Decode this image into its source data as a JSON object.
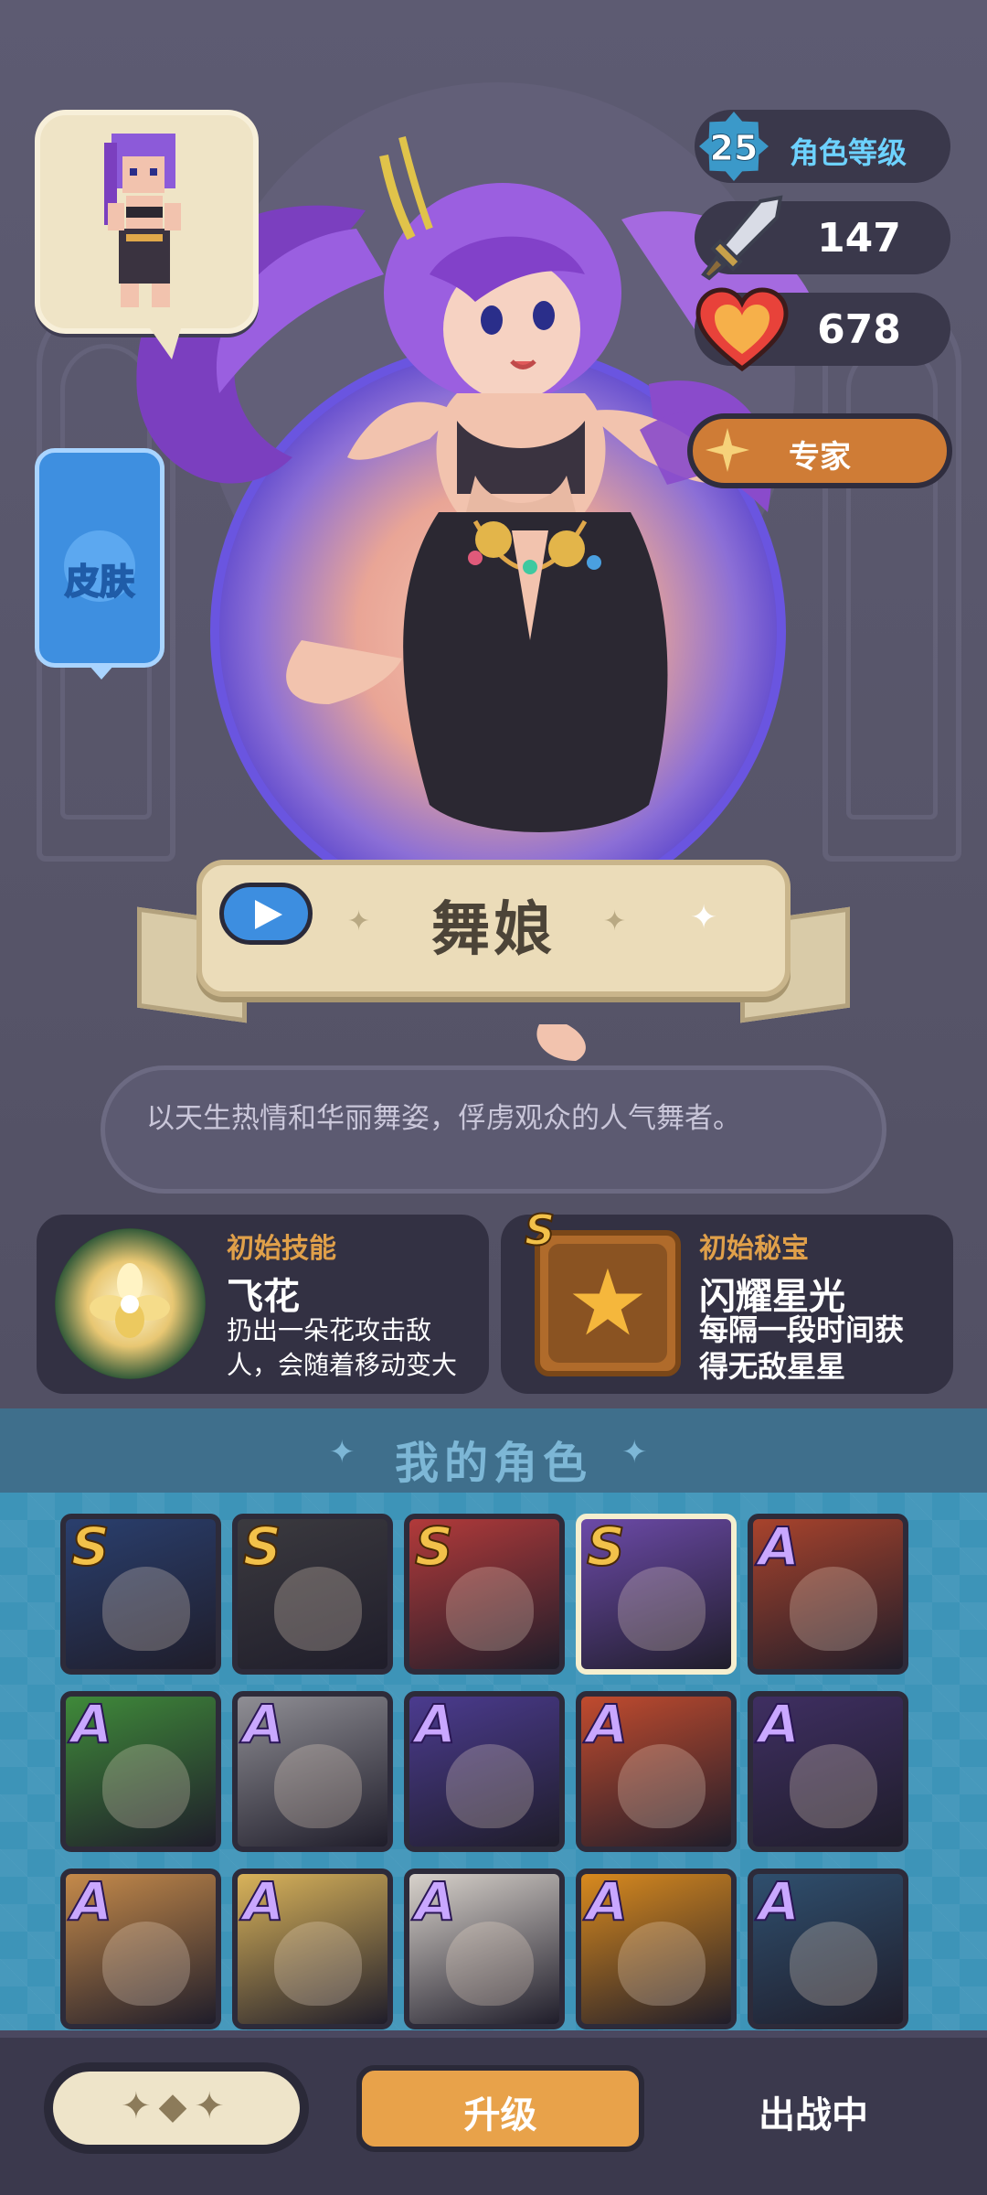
{
  "character": {
    "name": "舞娘",
    "description": "以天生热情和华丽舞姿，俘虏观众的人气舞者。"
  },
  "skin_button": {
    "label": "皮肤"
  },
  "stats": {
    "level": "25",
    "level_label": "角色等级",
    "attack": "147",
    "hp": "678",
    "rank_label": "专家"
  },
  "skill": {
    "header": "初始技能",
    "name": "飞花",
    "desc_line1": "扔出一朵花攻击敌",
    "desc_line2": "人，会随着移动变大"
  },
  "treasure": {
    "grade": "S",
    "header": "初始秘宝",
    "name": "闪耀星光",
    "desc_line1": "每隔一段时间获",
    "desc_line2": "得无敌星星"
  },
  "section": {
    "title": "我的角色"
  },
  "roster": [
    {
      "rank": "S",
      "color": "#2a3f6e"
    },
    {
      "rank": "S",
      "color": "#3b3a3f"
    },
    {
      "rank": "S",
      "color": "#b23a3a"
    },
    {
      "rank": "S",
      "color": "#6c4aa8",
      "selected": true
    },
    {
      "rank": "A",
      "color": "#a8432c"
    },
    {
      "rank": "A",
      "color": "#3f8a3a"
    },
    {
      "rank": "A",
      "color": "#8f8e94"
    },
    {
      "rank": "A",
      "color": "#4b3b8f"
    },
    {
      "rank": "A",
      "color": "#c14b2e"
    },
    {
      "rank": "A",
      "color": "#3f2f62"
    },
    {
      "rank": "A",
      "color": "#c58a4a"
    },
    {
      "rank": "A",
      "color": "#d9b35a"
    },
    {
      "rank": "A",
      "color": "#d8d2cb"
    },
    {
      "rank": "A",
      "color": "#d98a1e"
    },
    {
      "rank": "A",
      "color": "#2f4f6e"
    }
  ],
  "footer": {
    "upgrade_label": "升级",
    "status_label": "出战中"
  },
  "icons": {
    "play": "play-icon",
    "sword": "sword-icon",
    "heart": "heart-icon",
    "sparkle": "sparkle-icon",
    "star": "star-icon",
    "flower": "flower-icon"
  },
  "colors": {
    "accent_orange": "#cf7c36",
    "upgrade_orange": "#e8a24a",
    "level_blue": "#6dd2ff",
    "skill_gold": "#e0a04a",
    "section_bg": "#3f6f8c",
    "grid_bg": "#3d94b8"
  }
}
